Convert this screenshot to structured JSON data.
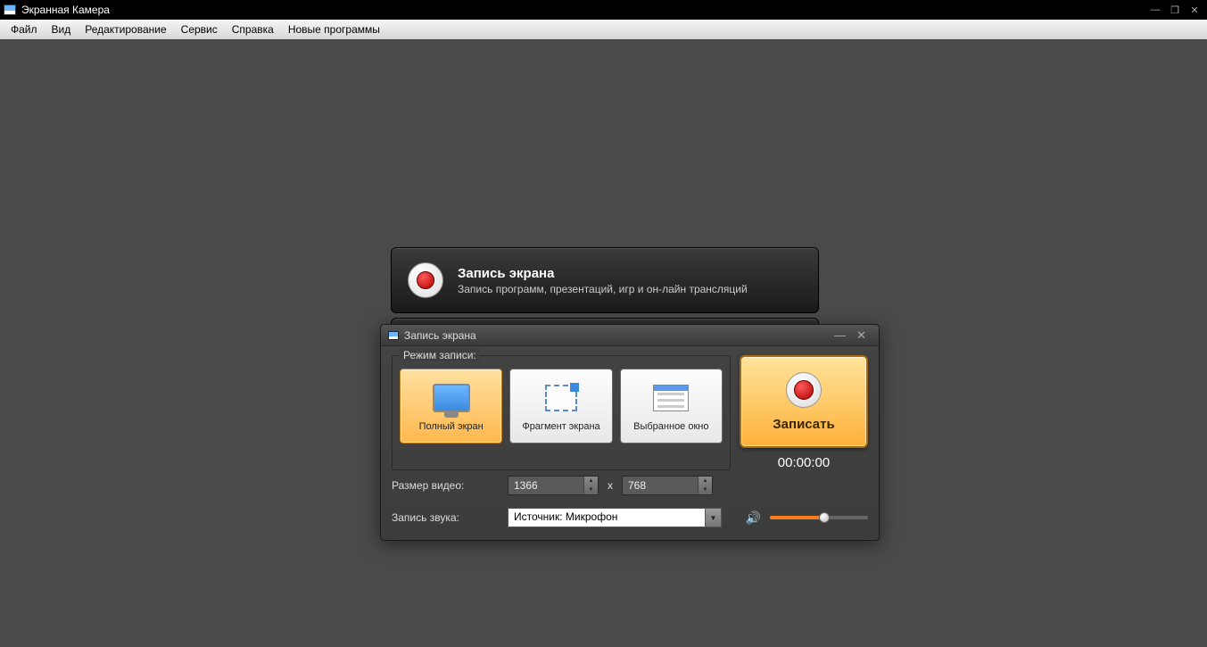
{
  "app": {
    "title": "Экранная Камера"
  },
  "menu": {
    "file": "Файл",
    "view": "Вид",
    "edit": "Редактирование",
    "service": "Сервис",
    "help": "Справка",
    "new_programs": "Новые программы"
  },
  "banner": {
    "title": "Запись экрана",
    "subtitle": "Запись программ, презентаций, игр и он-лайн трансляций"
  },
  "dialog": {
    "title": "Запись экрана",
    "mode_legend": "Режим записи:",
    "modes": {
      "full": "Полный экран",
      "fragment": "Фрагмент экрана",
      "window": "Выбранное окно"
    },
    "record_label": "Записать",
    "timer": "00:00:00",
    "size_label": "Размер видео:",
    "size_sep": "x",
    "width": "1366",
    "height": "768",
    "audio_label": "Запись звука:",
    "audio_source": "Источник: Микрофон"
  }
}
